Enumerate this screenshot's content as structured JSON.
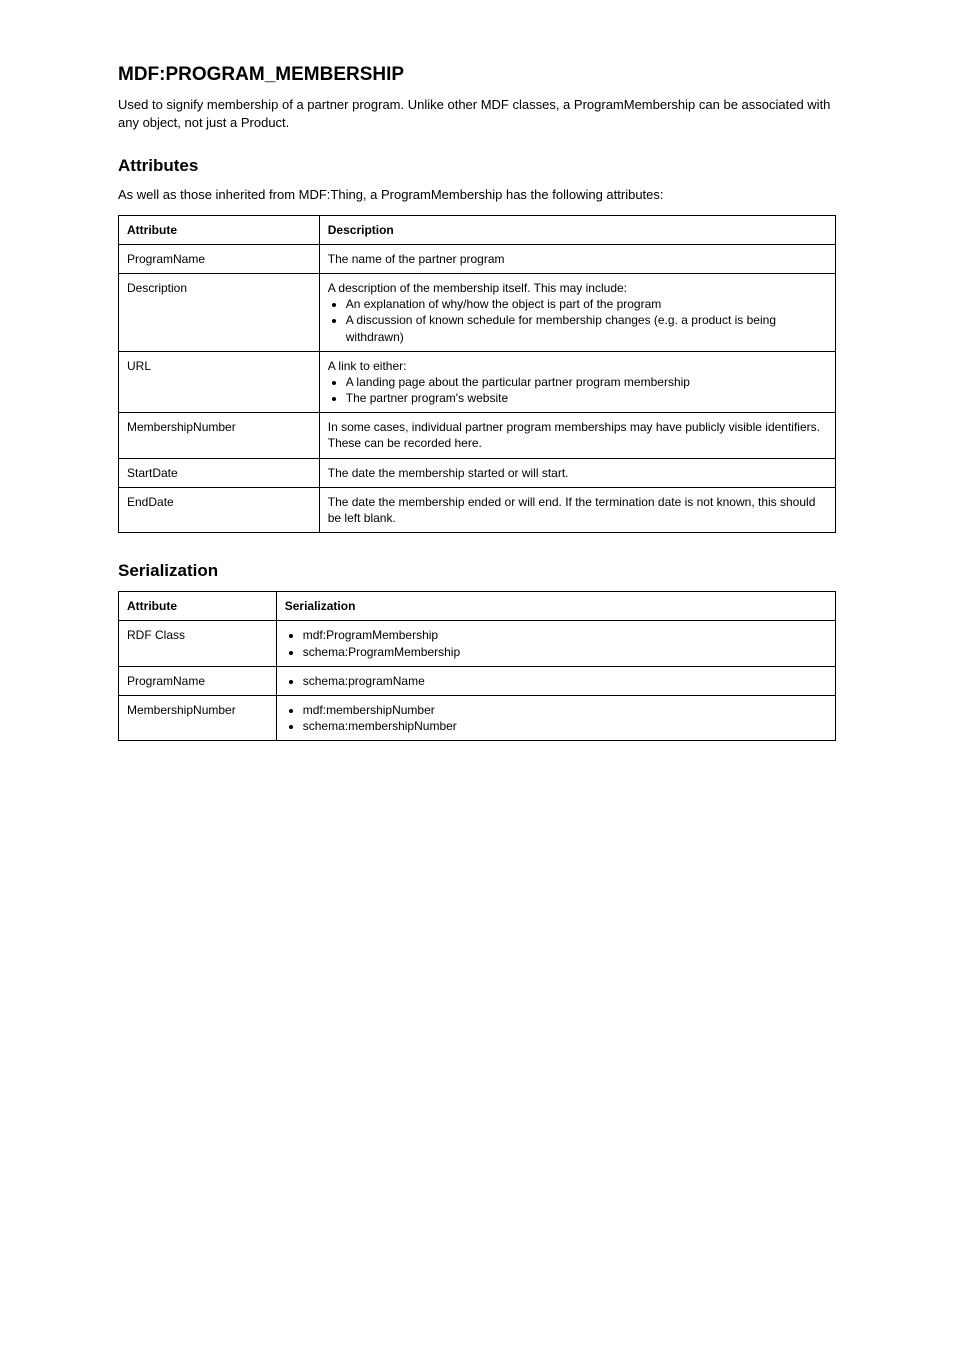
{
  "title": "MDF:PROGRAM_MEMBERSHIP",
  "intro": "Used to signify membership of a partner program. Unlike other MDF classes, a ProgramMembership can be associated with any object, not just a Product.",
  "attributesSection": {
    "heading": "Attributes",
    "sub": "As well as those inherited from MDF:Thing, a ProgramMembership has the following attributes:",
    "table": {
      "headers": [
        "Attribute",
        "Description"
      ],
      "rows": [
        {
          "attr": "ProgramName",
          "desc": "The name of the partner program"
        },
        {
          "attr": "Description",
          "desc_lead": "A description of the membership itself. This may include:",
          "items": [
            "An explanation of why/how the object is part of the program",
            "A discussion of known schedule for membership changes (e.g. a product is being withdrawn)"
          ]
        },
        {
          "attr": "URL",
          "desc_lead": "A link to either:",
          "items": [
            "A landing page about the particular partner program membership",
            "The partner program's website"
          ]
        },
        {
          "attr": "MembershipNumber",
          "desc": "In some cases, individual partner program memberships may have publicly visible identifiers. These can be recorded here."
        },
        {
          "attr": "StartDate",
          "desc": "The date the membership started or will start."
        },
        {
          "attr": "EndDate",
          "desc": "The date the membership ended or will end. If the termination date is not known, this should be left blank."
        }
      ]
    }
  },
  "serializationSection": {
    "heading": "Serialization",
    "table": {
      "headers": [
        "Attribute",
        "Serialization"
      ],
      "rows": [
        {
          "attr": "RDF Class",
          "items": [
            "mdf:ProgramMembership",
            "schema:ProgramMembership"
          ]
        },
        {
          "attr": "ProgramName",
          "items": [
            "schema:programName"
          ]
        },
        {
          "attr": "MembershipNumber",
          "items": [
            "mdf:membershipNumber",
            "schema:membershipNumber"
          ]
        }
      ]
    }
  }
}
